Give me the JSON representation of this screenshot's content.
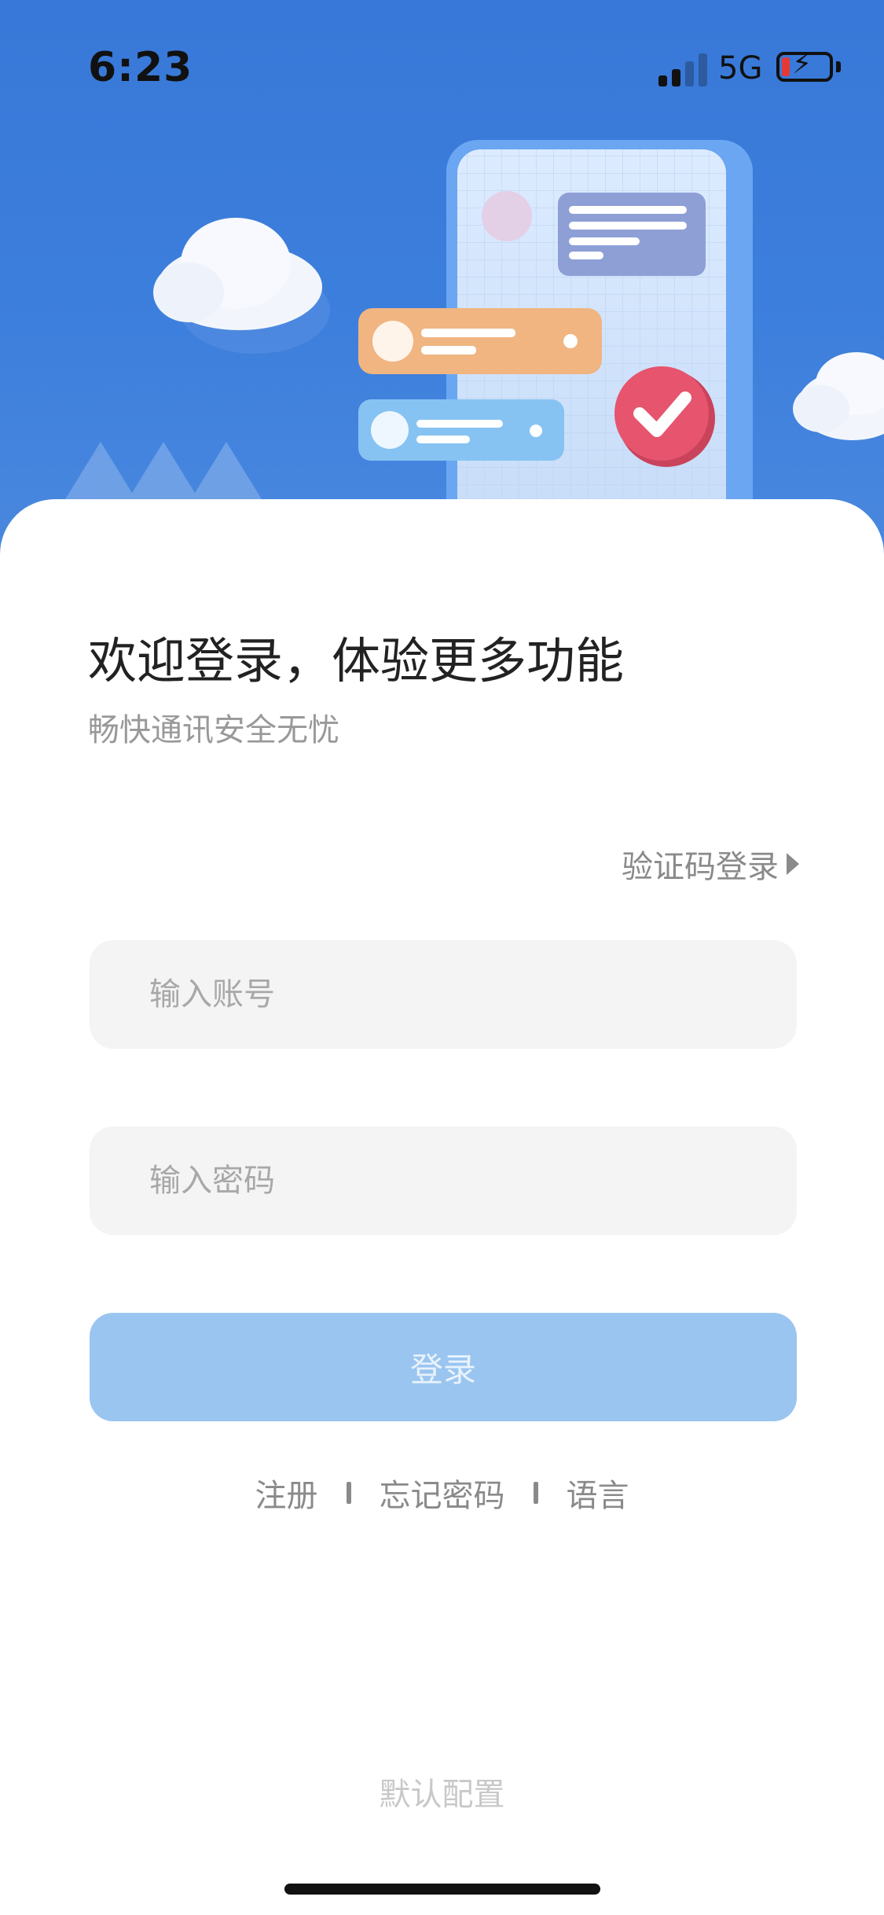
{
  "status_bar": {
    "time": "6:23",
    "network": "5G"
  },
  "header": {
    "title": "欢迎登录，体验更多功能",
    "subtitle": "畅快通讯安全无忧"
  },
  "login_switch": {
    "label": "验证码登录"
  },
  "account_field": {
    "placeholder": "输入账号",
    "value": ""
  },
  "password_field": {
    "placeholder": "输入密码",
    "value": ""
  },
  "login_button": {
    "label": "登录",
    "enabled": false
  },
  "footer_links": {
    "register": "注册",
    "forgot_password": "忘记密码",
    "language": "语言"
  },
  "default_config": "默认配置",
  "colors": {
    "hero_blue": "#3a7ad9",
    "button_disabled": "#9ac5f0",
    "field_bg": "#f4f4f4",
    "check_red": "#e6546e"
  },
  "icons": [
    "signal-icon",
    "battery-charging-icon",
    "chevron-right-icon",
    "check-badge-icon",
    "cloud-icon"
  ]
}
